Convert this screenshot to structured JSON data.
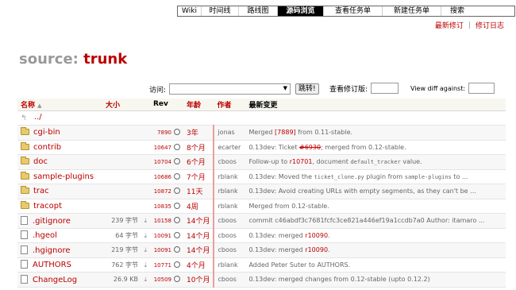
{
  "mainnav": [
    {
      "label": "Wiki",
      "active": false,
      "w": 30
    },
    {
      "label": "时间线",
      "active": false,
      "w": 47
    },
    {
      "label": "路线图",
      "active": false,
      "w": 49
    },
    {
      "label": "源码浏览",
      "active": true,
      "w": 58
    },
    {
      "label": "查看任务单",
      "active": false,
      "w": 74
    },
    {
      "label": "新建任务单",
      "active": false,
      "w": 74
    },
    {
      "label": "搜索",
      "active": false,
      "w": 40
    }
  ],
  "ctxtnav": {
    "latest_label": "最新修订",
    "log_label": "修订日志"
  },
  "page": {
    "source_label": "source:",
    "path": "trunk"
  },
  "jump": {
    "label": "访问:",
    "button": "跳转!"
  },
  "rev": {
    "label": "查看修订版:"
  },
  "diff": {
    "label": "View diff against:"
  },
  "columns": {
    "name": "名称",
    "size": "大小",
    "rev": "Rev",
    "age": "年龄",
    "author": "作者",
    "change": "最新变更"
  },
  "parent": {
    "label": "../"
  },
  "rows": [
    {
      "type": "dir",
      "name": "cgi-bin",
      "size": "",
      "rev": "7890",
      "age": "3年",
      "author": "jonas",
      "change": [
        {
          "t": "Merged "
        },
        {
          "t": "[7889]",
          "link": true
        },
        {
          "t": " from 0.11-stable."
        }
      ]
    },
    {
      "type": "dir",
      "name": "contrib",
      "size": "",
      "rev": "10647",
      "age": "8个月",
      "author": "ecarter",
      "change": [
        {
          "t": "0.13dev: Ticket "
        },
        {
          "t": "#6930",
          "strike": true
        },
        {
          "t": "; merged from 0.12-stable."
        }
      ]
    },
    {
      "type": "dir",
      "name": "doc",
      "size": "",
      "rev": "10704",
      "age": "6个月",
      "author": "cboos",
      "change": [
        {
          "t": "Follow-up to "
        },
        {
          "t": "r10701",
          "link": true
        },
        {
          "t": ", document "
        },
        {
          "t": "default_tracker",
          "code": true
        },
        {
          "t": " value."
        }
      ]
    },
    {
      "type": "dir",
      "name": "sample-plugins",
      "size": "",
      "rev": "10686",
      "age": "7个月",
      "author": "rblank",
      "change": [
        {
          "t": "0.13dev: Moved the "
        },
        {
          "t": "ticket_clone.py",
          "code": true
        },
        {
          "t": " plugin from "
        },
        {
          "t": "sample-plugins",
          "code": true
        },
        {
          "t": " to ..."
        }
      ]
    },
    {
      "type": "dir",
      "name": "trac",
      "size": "",
      "rev": "10872",
      "age": "11天",
      "author": "rblank",
      "change": [
        {
          "t": "0.13dev: Avoid creating URLs with empty segments, as they can't be ..."
        }
      ]
    },
    {
      "type": "dir",
      "name": "tracopt",
      "size": "",
      "rev": "10835",
      "age": "4周",
      "author": "rblank",
      "change": [
        {
          "t": "Merged from 0.12-stable."
        }
      ]
    },
    {
      "type": "file",
      "name": ".gitignore",
      "size": "239 字节",
      "rev": "10158",
      "age": "14个月",
      "author": "cboos",
      "change": [
        {
          "t": "commit c46abdf3c7681fcfc3ce821a446ef19a1ccdb7a0 Author: itamaro ..."
        }
      ]
    },
    {
      "type": "file",
      "name": ".hgeol",
      "size": "64 字节",
      "rev": "10091",
      "age": "14个月",
      "author": "cboos",
      "change": [
        {
          "t": "0.13dev: merged "
        },
        {
          "t": "r10090",
          "link": true
        },
        {
          "t": "."
        }
      ]
    },
    {
      "type": "file",
      "name": ".hgignore",
      "size": "219 字节",
      "rev": "10091",
      "age": "14个月",
      "author": "cboos",
      "change": [
        {
          "t": "0.13dev: merged "
        },
        {
          "t": "r10090",
          "link": true
        },
        {
          "t": "."
        }
      ]
    },
    {
      "type": "file",
      "name": "AUTHORS",
      "size": "762 字节",
      "rev": "10771",
      "age": "4个月",
      "author": "rblank",
      "change": [
        {
          "t": "Added Peter Suter to AUTHORS."
        }
      ]
    },
    {
      "type": "file",
      "name": "ChangeLog",
      "size": "26.9 KB",
      "rev": "10509",
      "age": "10个月",
      "author": "cboos",
      "change": [
        {
          "t": "0.13dev: merged changes from 0.12-stable (upto 0.12.2)"
        }
      ]
    }
  ]
}
